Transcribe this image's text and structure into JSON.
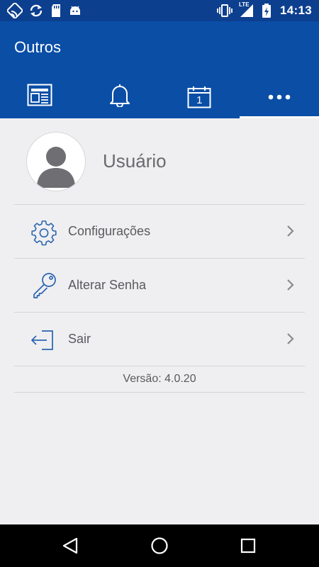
{
  "status_bar": {
    "time": "14:13",
    "network_label": "LTE",
    "left_icons": [
      "cast-icon",
      "sync-icon",
      "sd-card-icon",
      "android-icon"
    ],
    "right_icons": [
      "vibrate-icon",
      "signal-icon",
      "battery-charging-icon"
    ]
  },
  "app_bar": {
    "title": "Outros",
    "tabs": [
      {
        "icon": "news-icon",
        "selected": false
      },
      {
        "icon": "bell-icon",
        "selected": false
      },
      {
        "icon": "calendar-icon",
        "calendar_day": "1",
        "selected": false
      },
      {
        "icon": "more-icon",
        "selected": true
      }
    ]
  },
  "profile": {
    "name": "Usuário",
    "avatar_icon": "user-avatar-icon"
  },
  "menu": {
    "items": [
      {
        "label": "Configurações",
        "icon": "gear-icon"
      },
      {
        "label": "Alterar Senha",
        "icon": "key-icon"
      },
      {
        "label": "Sair",
        "icon": "logout-icon"
      }
    ],
    "version": "Versão: 4.0.20"
  },
  "nav_bar": {
    "buttons": [
      "back-icon",
      "home-icon",
      "recents-icon"
    ]
  },
  "colors": {
    "status_bar": "#0d3f8f",
    "app_bar": "#0a4ea6",
    "background": "#efeff1",
    "icon_accent": "#2a64b0"
  }
}
